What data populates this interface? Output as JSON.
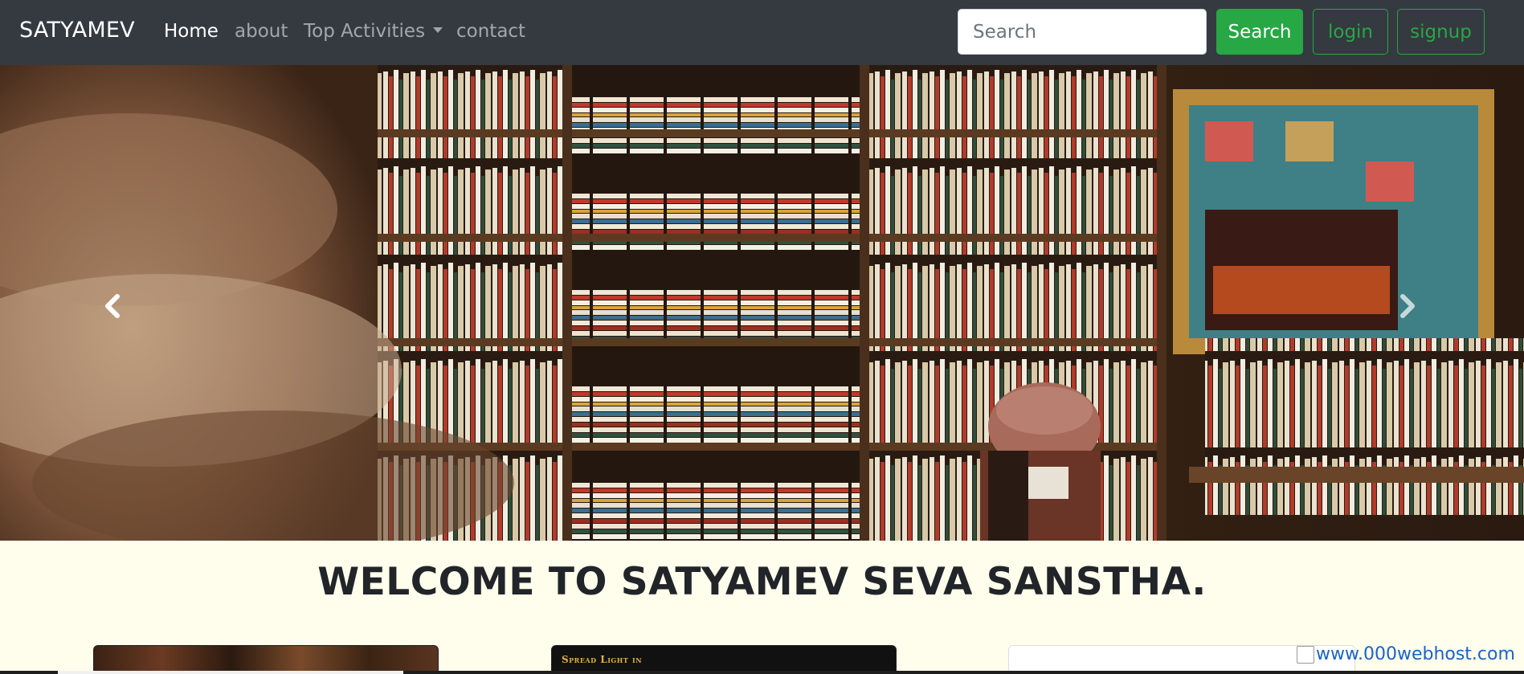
{
  "navbar": {
    "brand": "SATYAMEV",
    "links": [
      {
        "label": "Home",
        "active": true
      },
      {
        "label": "about",
        "active": false
      },
      {
        "label": "Top Activities",
        "active": false,
        "dropdown": true
      },
      {
        "label": "contact",
        "active": false
      }
    ],
    "search_placeholder": "Search",
    "search_button": "Search",
    "login_button": "login",
    "signup_button": "signup"
  },
  "hero": {
    "image": "bookshelf-photo",
    "prev_icon": "chevron-left-icon",
    "next_icon": "chevron-right-icon"
  },
  "welcome": {
    "heading": "WELCOME TO SATYAMEV SEVA SANSTHA."
  },
  "cards": {
    "card2_title": "Spread Light in"
  },
  "host_badge": "www.000webhost.com",
  "colors": {
    "navbar_bg": "#343a40",
    "success": "#28a745",
    "page_bg": "#fffdec",
    "link": "#1a63c7"
  }
}
